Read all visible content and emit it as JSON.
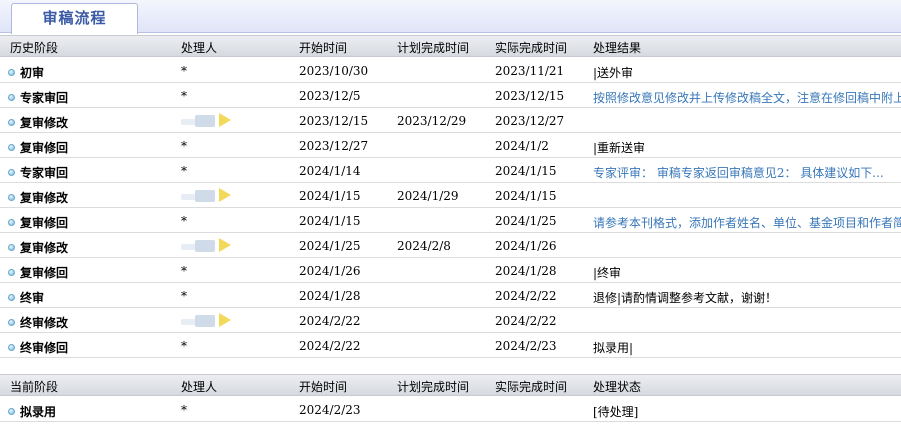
{
  "tab": {
    "label": "审稿流程"
  },
  "history": {
    "columns": [
      "历史阶段",
      "处理人",
      "开始时间",
      "计划完成时间",
      "实际完成时间",
      "处理结果"
    ],
    "rows": [
      {
        "stage": "初审",
        "handler": "*",
        "start": "2023/10/30",
        "plan": "",
        "actual": "2023/11/21",
        "result": "|送外审",
        "result_link": false,
        "handler_blurred": false
      },
      {
        "stage": "专家审回",
        "handler": "*",
        "start": "2023/12/5",
        "plan": "",
        "actual": "2023/12/15",
        "result": "按照修改意见修改并上传修改稿全文，注意在修回稿中附上",
        "result_link": true,
        "handler_blurred": false
      },
      {
        "stage": "复审修改",
        "handler": "",
        "start": "2023/12/15",
        "plan": "2023/12/29",
        "actual": "2023/12/27",
        "result": "",
        "result_link": false,
        "handler_blurred": true
      },
      {
        "stage": "复审修回",
        "handler": "*",
        "start": "2023/12/27",
        "plan": "",
        "actual": "2024/1/2",
        "result": "|重新送审",
        "result_link": false,
        "handler_blurred": false
      },
      {
        "stage": "专家审回",
        "handler": "*",
        "start": "2024/1/14",
        "plan": "",
        "actual": "2024/1/15",
        "result": "专家评审：  审稿专家返回审稿意见2： 具体建议如下...",
        "result_link": true,
        "handler_blurred": false
      },
      {
        "stage": "复审修改",
        "handler": "",
        "start": "2024/1/15",
        "plan": "2024/1/29",
        "actual": "2024/1/15",
        "result": "",
        "result_link": false,
        "handler_blurred": true
      },
      {
        "stage": "复审修回",
        "handler": "*",
        "start": "2024/1/15",
        "plan": "",
        "actual": "2024/1/25",
        "result": "请参考本刊格式，添加作者姓名、单位、基金项目和作者简",
        "result_link": true,
        "handler_blurred": false
      },
      {
        "stage": "复审修改",
        "handler": "",
        "start": "2024/1/25",
        "plan": "2024/2/8",
        "actual": "2024/1/26",
        "result": "",
        "result_link": false,
        "handler_blurred": true
      },
      {
        "stage": "复审修回",
        "handler": "*",
        "start": "2024/1/26",
        "plan": "",
        "actual": "2024/1/28",
        "result": "|终审",
        "result_link": false,
        "handler_blurred": false
      },
      {
        "stage": "终审",
        "handler": "*",
        "start": "2024/1/28",
        "plan": "",
        "actual": "2024/2/22",
        "result": "退修|请酌情调整参考文献，谢谢！",
        "result_link": false,
        "handler_blurred": false
      },
      {
        "stage": "终审修改",
        "handler": "",
        "start": "2024/2/22",
        "plan": "",
        "actual": "2024/2/22",
        "result": "",
        "result_link": false,
        "handler_blurred": true
      },
      {
        "stage": "终审修回",
        "handler": "*",
        "start": "2024/2/22",
        "plan": "",
        "actual": "2024/2/23",
        "result": "拟录用|",
        "result_link": false,
        "handler_blurred": false
      }
    ]
  },
  "current": {
    "columns": [
      "当前阶段",
      "处理人",
      "开始时间",
      "计划完成时间",
      "实际完成时间",
      "处理状态"
    ],
    "rows": [
      {
        "stage": "拟录用",
        "handler": "*",
        "start": "2024/2/23",
        "plan": "",
        "actual": "",
        "result": "[待处理]",
        "result_link": false,
        "handler_blurred": false
      }
    ]
  },
  "colors": {
    "link": "#3877b8",
    "tab_text": "#3a5aa6",
    "send_icon": "#f3d95a"
  }
}
